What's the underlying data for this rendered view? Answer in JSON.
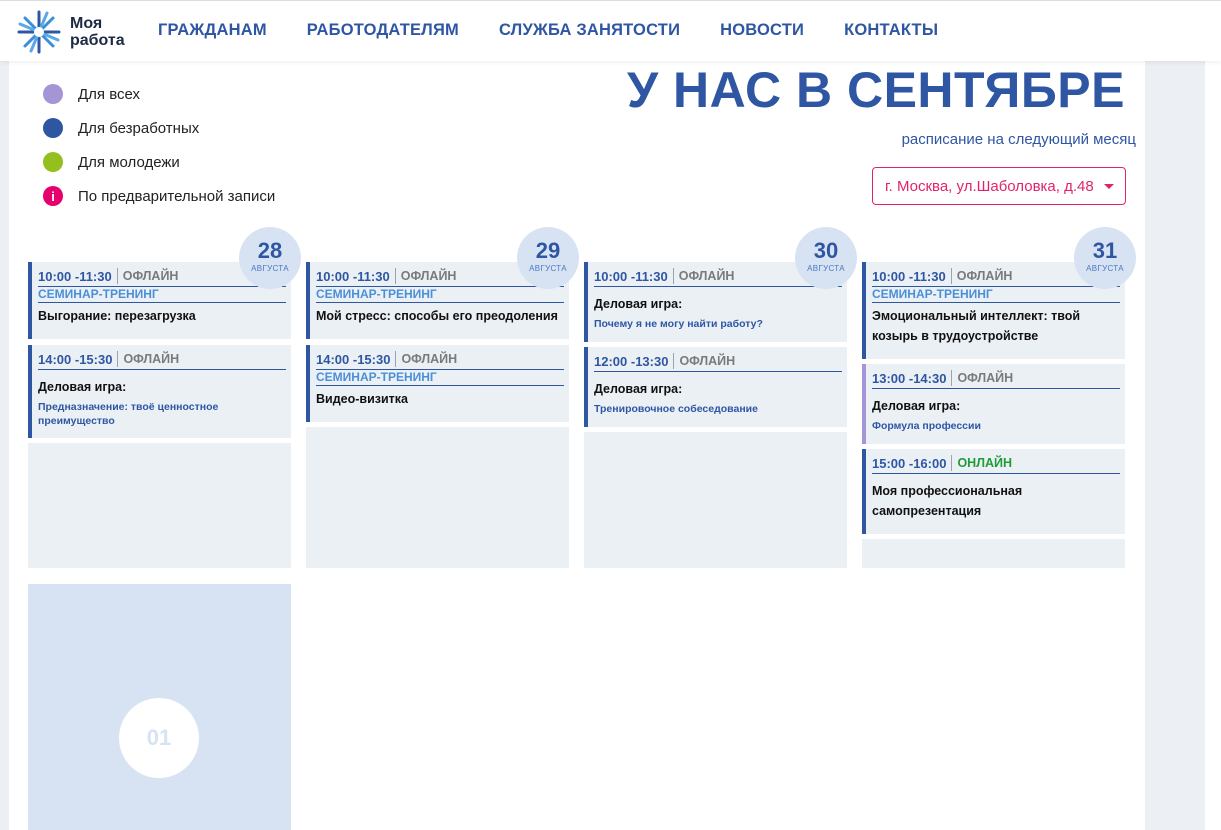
{
  "logo": {
    "text": "Моя\nработа"
  },
  "nav": [
    "ГРАЖДАНАМ",
    "РАБОТОДАТЕЛЯМ",
    "СЛУЖБА ЗАНЯТОСТИ",
    "НОВОСТИ",
    "КОНТАКТЫ"
  ],
  "legend": [
    {
      "label": "Для всех",
      "color": "#a594d6"
    },
    {
      "label": "Для безработных",
      "color": "#2f56a3"
    },
    {
      "label": "Для молодежи",
      "color": "#93c01f"
    },
    {
      "label": "По предварительной записи",
      "color": "#e5006b",
      "icon": "i"
    }
  ],
  "header_title": "У НАС В СЕНТЯБРЕ",
  "subtitle": "расписание на следующий месяц",
  "location": "г. Москва, ул.Шаболовка, д.48",
  "days": [
    {
      "num": "28",
      "month": "АВГУСТА",
      "events": [
        {
          "time": "10:00 -11:30",
          "mode": "ОФЛАЙН",
          "category": "СЕМИНАР-ТРЕНИНГ",
          "title": "Выгорание: перезагрузка",
          "sub": ""
        },
        {
          "time": "14:00 -15:30",
          "mode": "ОФЛАЙН",
          "category": "",
          "title": "Деловая игра:",
          "sub": "Предназначение: твоё ценностное преимущество"
        }
      ]
    },
    {
      "num": "29",
      "month": "АВГУСТА",
      "events": [
        {
          "time": "10:00 -11:30",
          "mode": "ОФЛАЙН",
          "category": "СЕМИНАР-ТРЕНИНГ",
          "title": "Мой стресс: способы его преодоления",
          "sub": ""
        },
        {
          "time": "14:00 -15:30",
          "mode": "ОФЛАЙН",
          "category": "СЕМИНАР-ТРЕНИНГ",
          "title": "Видео-визитка",
          "sub": ""
        }
      ]
    },
    {
      "num": "30",
      "month": "АВГУСТА",
      "events": [
        {
          "time": "10:00 -11:30",
          "mode": "ОФЛАЙН",
          "category": "",
          "title": "Деловая игра:",
          "sub": "Почему я не могу найти работу?"
        },
        {
          "time": "12:00 -13:30",
          "mode": "ОФЛАЙН",
          "category": "",
          "title": "Деловая игра:",
          "sub": "Тренировочное собеседование"
        }
      ]
    },
    {
      "num": "31",
      "month": "АВГУСТА",
      "events": [
        {
          "time": "10:00 -11:30",
          "mode": "ОФЛАЙН",
          "category": "СЕМИНАР-ТРЕНИНГ",
          "title": "Эмоциональный интеллект: твой козырь в трудоустройстве",
          "sub": ""
        },
        {
          "time": "13:00 -14:30",
          "mode": "ОФЛАЙН",
          "category": "",
          "title": "Деловая игра:",
          "sub": "Формула профессии"
        },
        {
          "time": "15:00 -16:00",
          "mode": "ОНЛАЙН",
          "category": "",
          "title": "Моя профессиональная самопрезентация",
          "sub": ""
        }
      ]
    }
  ],
  "next_day": "01"
}
